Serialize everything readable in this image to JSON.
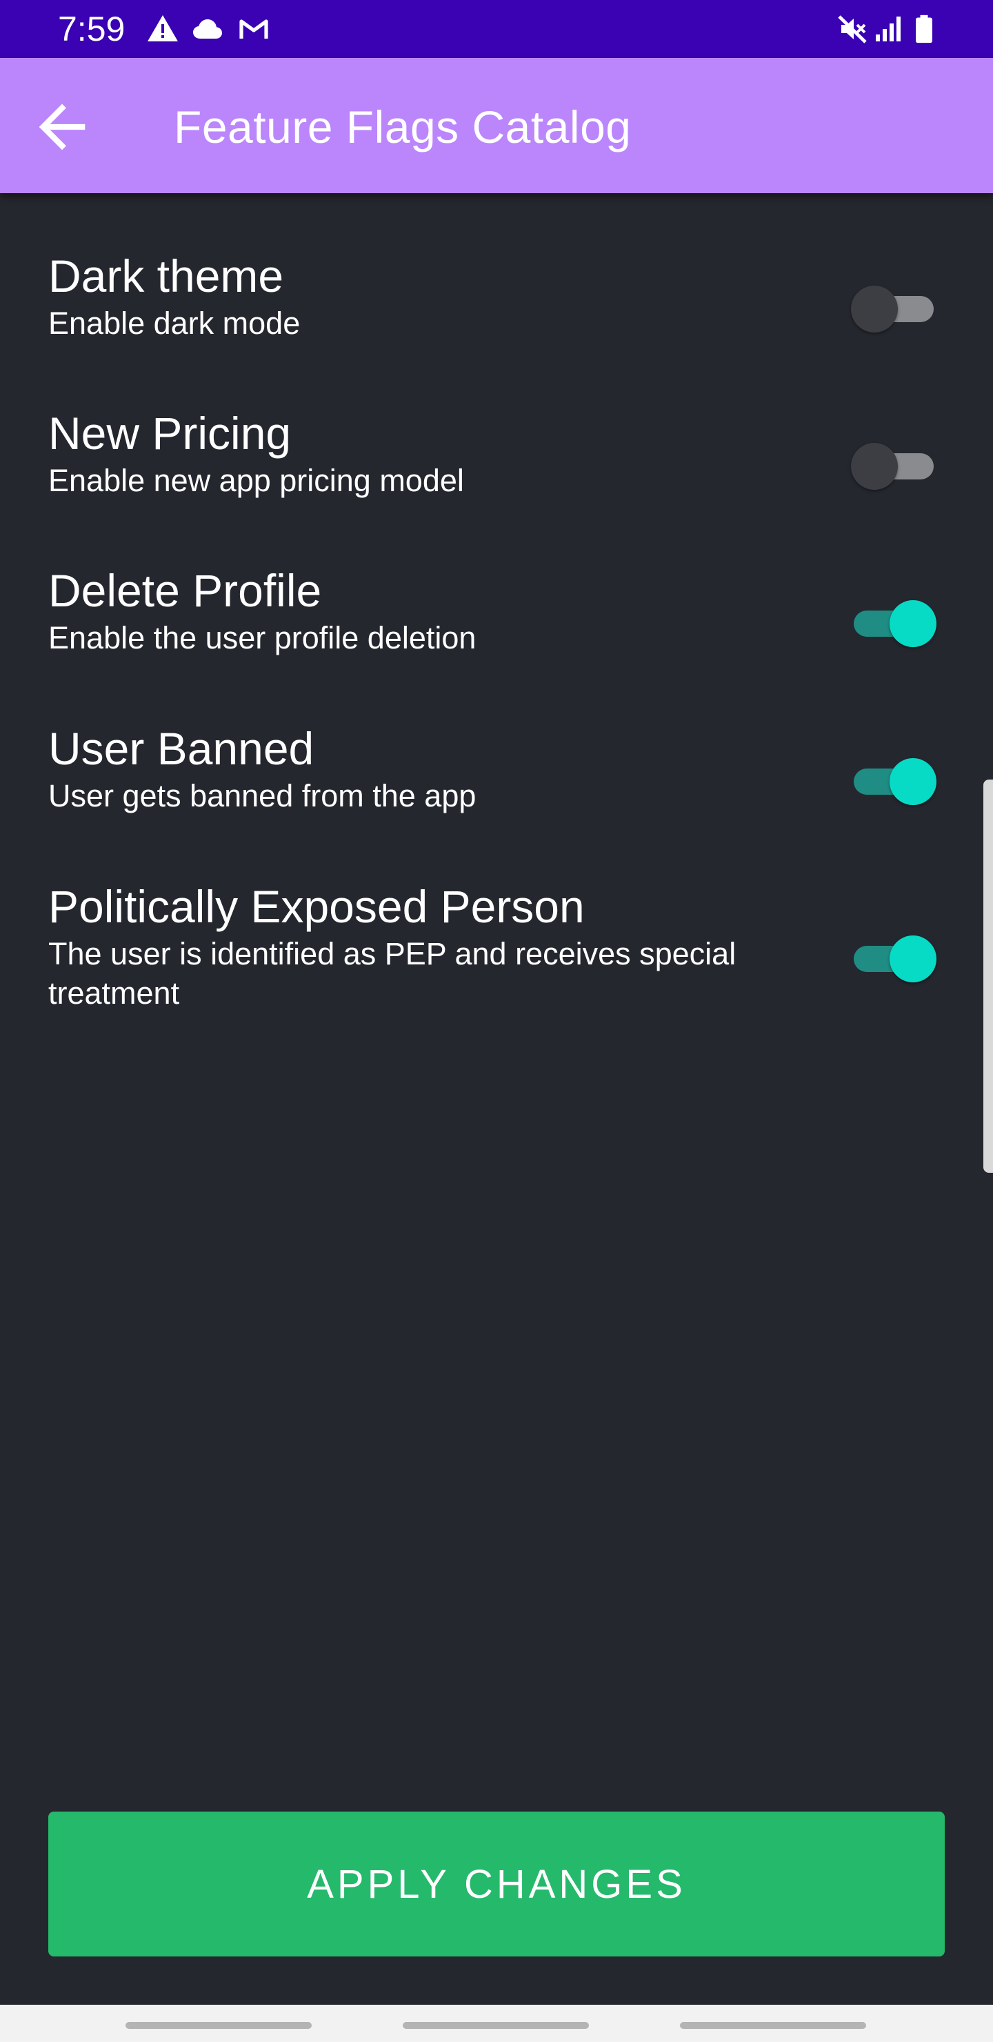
{
  "status_bar": {
    "time": "7:59",
    "left_icons": [
      "warning-icon",
      "cloud-icon",
      "gmail-icon"
    ],
    "right_icons": [
      "mute-icon",
      "signal-icon",
      "battery-icon"
    ],
    "background_color": "#3a02b2"
  },
  "app_bar": {
    "title": "Feature Flags Catalog",
    "back_icon": "arrow-back-icon",
    "background_color": "#bb86fc"
  },
  "flags": [
    {
      "title": "Dark theme",
      "description": "Enable dark mode",
      "enabled": false
    },
    {
      "title": "New Pricing",
      "description": "Enable new app pricing model",
      "enabled": false
    },
    {
      "title": "Delete Profile",
      "description": "Enable the user profile deletion",
      "enabled": true
    },
    {
      "title": "User Banned",
      "description": "User gets banned from the app",
      "enabled": true
    },
    {
      "title": "Politically Exposed Person",
      "description": "The user is identified as PEP and receives special treatment",
      "enabled": true
    }
  ],
  "apply_button": {
    "label": "APPLY CHANGES",
    "color": "#25b96b"
  },
  "theme": {
    "background": "#25272f",
    "toggle_on_thumb": "#07dbc6",
    "toggle_on_track": "#1f8d83",
    "toggle_off_thumb": "#3c3e44",
    "toggle_off_track": "#8a8b8f"
  }
}
